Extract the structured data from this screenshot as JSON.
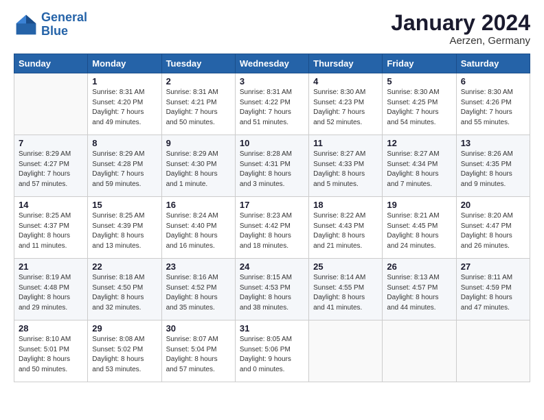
{
  "header": {
    "logo_line1": "General",
    "logo_line2": "Blue",
    "month_title": "January 2024",
    "location": "Aerzen, Germany"
  },
  "weekdays": [
    "Sunday",
    "Monday",
    "Tuesday",
    "Wednesday",
    "Thursday",
    "Friday",
    "Saturday"
  ],
  "weeks": [
    [
      {
        "day": "",
        "sunrise": "",
        "sunset": "",
        "daylight": ""
      },
      {
        "day": "1",
        "sunrise": "Sunrise: 8:31 AM",
        "sunset": "Sunset: 4:20 PM",
        "daylight": "Daylight: 7 hours and 49 minutes."
      },
      {
        "day": "2",
        "sunrise": "Sunrise: 8:31 AM",
        "sunset": "Sunset: 4:21 PM",
        "daylight": "Daylight: 7 hours and 50 minutes."
      },
      {
        "day": "3",
        "sunrise": "Sunrise: 8:31 AM",
        "sunset": "Sunset: 4:22 PM",
        "daylight": "Daylight: 7 hours and 51 minutes."
      },
      {
        "day": "4",
        "sunrise": "Sunrise: 8:30 AM",
        "sunset": "Sunset: 4:23 PM",
        "daylight": "Daylight: 7 hours and 52 minutes."
      },
      {
        "day": "5",
        "sunrise": "Sunrise: 8:30 AM",
        "sunset": "Sunset: 4:25 PM",
        "daylight": "Daylight: 7 hours and 54 minutes."
      },
      {
        "day": "6",
        "sunrise": "Sunrise: 8:30 AM",
        "sunset": "Sunset: 4:26 PM",
        "daylight": "Daylight: 7 hours and 55 minutes."
      }
    ],
    [
      {
        "day": "7",
        "sunrise": "Sunrise: 8:29 AM",
        "sunset": "Sunset: 4:27 PM",
        "daylight": "Daylight: 7 hours and 57 minutes."
      },
      {
        "day": "8",
        "sunrise": "Sunrise: 8:29 AM",
        "sunset": "Sunset: 4:28 PM",
        "daylight": "Daylight: 7 hours and 59 minutes."
      },
      {
        "day": "9",
        "sunrise": "Sunrise: 8:29 AM",
        "sunset": "Sunset: 4:30 PM",
        "daylight": "Daylight: 8 hours and 1 minute."
      },
      {
        "day": "10",
        "sunrise": "Sunrise: 8:28 AM",
        "sunset": "Sunset: 4:31 PM",
        "daylight": "Daylight: 8 hours and 3 minutes."
      },
      {
        "day": "11",
        "sunrise": "Sunrise: 8:27 AM",
        "sunset": "Sunset: 4:33 PM",
        "daylight": "Daylight: 8 hours and 5 minutes."
      },
      {
        "day": "12",
        "sunrise": "Sunrise: 8:27 AM",
        "sunset": "Sunset: 4:34 PM",
        "daylight": "Daylight: 8 hours and 7 minutes."
      },
      {
        "day": "13",
        "sunrise": "Sunrise: 8:26 AM",
        "sunset": "Sunset: 4:35 PM",
        "daylight": "Daylight: 8 hours and 9 minutes."
      }
    ],
    [
      {
        "day": "14",
        "sunrise": "Sunrise: 8:25 AM",
        "sunset": "Sunset: 4:37 PM",
        "daylight": "Daylight: 8 hours and 11 minutes."
      },
      {
        "day": "15",
        "sunrise": "Sunrise: 8:25 AM",
        "sunset": "Sunset: 4:39 PM",
        "daylight": "Daylight: 8 hours and 13 minutes."
      },
      {
        "day": "16",
        "sunrise": "Sunrise: 8:24 AM",
        "sunset": "Sunset: 4:40 PM",
        "daylight": "Daylight: 8 hours and 16 minutes."
      },
      {
        "day": "17",
        "sunrise": "Sunrise: 8:23 AM",
        "sunset": "Sunset: 4:42 PM",
        "daylight": "Daylight: 8 hours and 18 minutes."
      },
      {
        "day": "18",
        "sunrise": "Sunrise: 8:22 AM",
        "sunset": "Sunset: 4:43 PM",
        "daylight": "Daylight: 8 hours and 21 minutes."
      },
      {
        "day": "19",
        "sunrise": "Sunrise: 8:21 AM",
        "sunset": "Sunset: 4:45 PM",
        "daylight": "Daylight: 8 hours and 24 minutes."
      },
      {
        "day": "20",
        "sunrise": "Sunrise: 8:20 AM",
        "sunset": "Sunset: 4:47 PM",
        "daylight": "Daylight: 8 hours and 26 minutes."
      }
    ],
    [
      {
        "day": "21",
        "sunrise": "Sunrise: 8:19 AM",
        "sunset": "Sunset: 4:48 PM",
        "daylight": "Daylight: 8 hours and 29 minutes."
      },
      {
        "day": "22",
        "sunrise": "Sunrise: 8:18 AM",
        "sunset": "Sunset: 4:50 PM",
        "daylight": "Daylight: 8 hours and 32 minutes."
      },
      {
        "day": "23",
        "sunrise": "Sunrise: 8:16 AM",
        "sunset": "Sunset: 4:52 PM",
        "daylight": "Daylight: 8 hours and 35 minutes."
      },
      {
        "day": "24",
        "sunrise": "Sunrise: 8:15 AM",
        "sunset": "Sunset: 4:53 PM",
        "daylight": "Daylight: 8 hours and 38 minutes."
      },
      {
        "day": "25",
        "sunrise": "Sunrise: 8:14 AM",
        "sunset": "Sunset: 4:55 PM",
        "daylight": "Daylight: 8 hours and 41 minutes."
      },
      {
        "day": "26",
        "sunrise": "Sunrise: 8:13 AM",
        "sunset": "Sunset: 4:57 PM",
        "daylight": "Daylight: 8 hours and 44 minutes."
      },
      {
        "day": "27",
        "sunrise": "Sunrise: 8:11 AM",
        "sunset": "Sunset: 4:59 PM",
        "daylight": "Daylight: 8 hours and 47 minutes."
      }
    ],
    [
      {
        "day": "28",
        "sunrise": "Sunrise: 8:10 AM",
        "sunset": "Sunset: 5:01 PM",
        "daylight": "Daylight: 8 hours and 50 minutes."
      },
      {
        "day": "29",
        "sunrise": "Sunrise: 8:08 AM",
        "sunset": "Sunset: 5:02 PM",
        "daylight": "Daylight: 8 hours and 53 minutes."
      },
      {
        "day": "30",
        "sunrise": "Sunrise: 8:07 AM",
        "sunset": "Sunset: 5:04 PM",
        "daylight": "Daylight: 8 hours and 57 minutes."
      },
      {
        "day": "31",
        "sunrise": "Sunrise: 8:05 AM",
        "sunset": "Sunset: 5:06 PM",
        "daylight": "Daylight: 9 hours and 0 minutes."
      },
      {
        "day": "",
        "sunrise": "",
        "sunset": "",
        "daylight": ""
      },
      {
        "day": "",
        "sunrise": "",
        "sunset": "",
        "daylight": ""
      },
      {
        "day": "",
        "sunrise": "",
        "sunset": "",
        "daylight": ""
      }
    ]
  ]
}
